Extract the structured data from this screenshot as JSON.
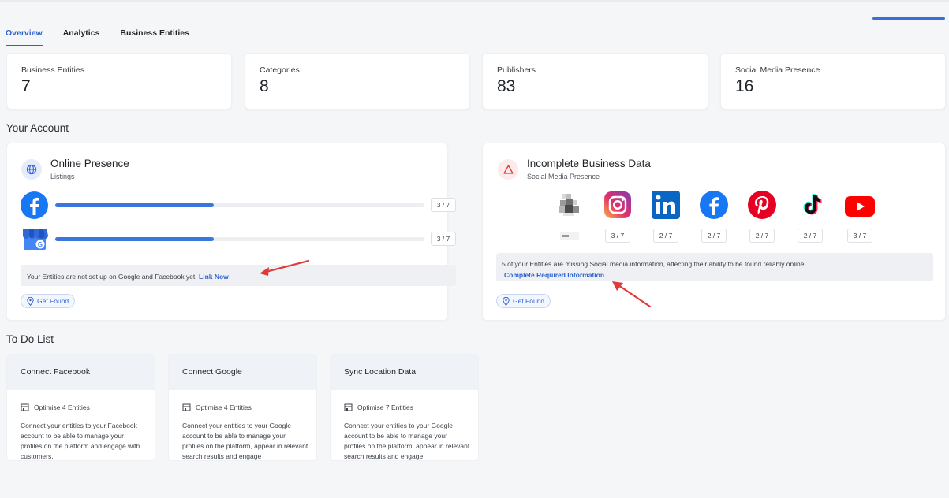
{
  "tabs": [
    {
      "label": "Overview",
      "active": true
    },
    {
      "label": "Analytics",
      "active": false
    },
    {
      "label": "Business Entities",
      "active": false
    }
  ],
  "stats": [
    {
      "label": "Business Entities",
      "value": "7"
    },
    {
      "label": "Categories",
      "value": "8"
    },
    {
      "label": "Publishers",
      "value": "83"
    },
    {
      "label": "Social Media Presence",
      "value": "16"
    }
  ],
  "your_account": {
    "title": "Your Account",
    "online_presence": {
      "icon": "globe-icon",
      "title": "Online Presence",
      "subtitle": "Listings",
      "rows": [
        {
          "icon": "facebook-icon",
          "count": "3 / 7",
          "progress": 0.43
        },
        {
          "icon": "google-business-icon",
          "count": "3 / 7",
          "progress": 0.43
        }
      ],
      "notice_text": "Your Entities are not set up on Google and Facebook yet.",
      "notice_link": "Link Now",
      "button": "Get Found"
    },
    "incomplete_data": {
      "icon": "warning-icon",
      "title": "Incomplete Business Data",
      "subtitle": "Social Media Presence",
      "socials": [
        {
          "icon": "pixelated-icon",
          "count": ""
        },
        {
          "icon": "instagram-icon",
          "count": "3 / 7"
        },
        {
          "icon": "linkedin-icon",
          "count": "2 / 7"
        },
        {
          "icon": "facebook-icon",
          "count": "2 / 7"
        },
        {
          "icon": "pinterest-icon",
          "count": "2 / 7"
        },
        {
          "icon": "tiktok-icon",
          "count": "2 / 7"
        },
        {
          "icon": "youtube-icon",
          "count": "3 / 7"
        }
      ],
      "notice_text": "5 of your Entities are missing Social media information, affecting their ability to be found reliably online.",
      "notice_link": "Complete Required Information",
      "button": "Get Found"
    }
  },
  "todo": {
    "title": "To Do List",
    "items": [
      {
        "title": "Connect Facebook",
        "meta": "Optimise 4 Entities",
        "desc": "Connect your entities to your Facebook account to be able to manage your profiles on the platform and engage with customers."
      },
      {
        "title": "Connect Google",
        "meta": "Optimise 4 Entities",
        "desc": "Connect your entities to your Google account to be able to manage your profiles on the platform, appear in relevant search results and engage"
      },
      {
        "title": "Sync Location Data",
        "meta": "Optimise 7 Entities",
        "desc": "Connect your entities to your Google account to be able to manage your profiles on the platform, appear in relevant search results and engage"
      }
    ]
  },
  "colors": {
    "accent": "#2f63d1",
    "bar": "#3b76e0",
    "annotation_arrow": "#e03a3a"
  }
}
